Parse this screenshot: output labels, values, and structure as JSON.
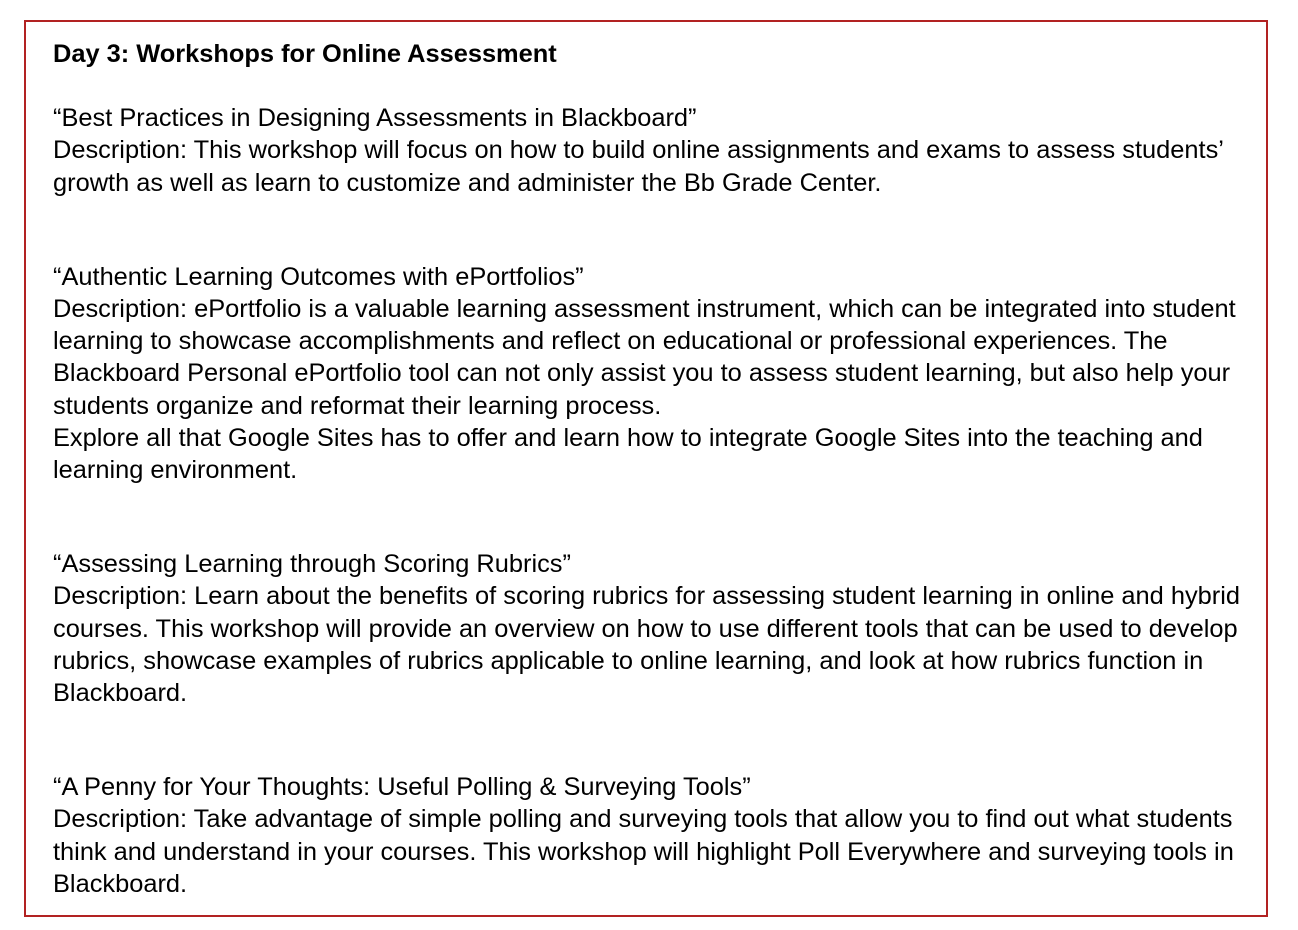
{
  "document": {
    "heading": "Day 3: Workshops for Online Assessment",
    "workshops": [
      {
        "title": "“Best Practices in Designing Assessments in Blackboard”",
        "description": "Description: This workshop will focus on how to build online assignments and exams to assess students’ growth as well as learn to customize and administer the Bb Grade Center.",
        "extra": ""
      },
      {
        "title": "“Authentic Learning Outcomes with ePortfolios”",
        "description": "Description: ePortfolio is a valuable learning assessment instrument, which can be integrated into student learning to showcase accomplishments and reflect on educational or professional experiences. The Blackboard Personal ePortfolio tool can not only assist you to assess student learning, but also help your students organize and reformat their learning process.",
        "extra": "Explore all that Google Sites has to offer and learn how to integrate Google Sites into the teaching and learning environment."
      },
      {
        "title": "“Assessing Learning through Scoring Rubrics”",
        "description": "Description: Learn about the benefits of scoring rubrics for assessing student learning in online and hybrid courses. This workshop will provide an overview on how to use different tools that can be used to develop rubrics, showcase examples of rubrics applicable to online learning, and look at how rubrics function in Blackboard.",
        "extra": ""
      },
      {
        "title": "“A Penny for Your Thoughts: Useful Polling & Surveying Tools”",
        "description": "Description: Take advantage of simple polling and surveying tools that allow you to find out what students think and understand in your courses. This workshop will highlight Poll Everywhere and surveying tools in Blackboard.",
        "extra": ""
      }
    ],
    "border_color": "#b22222"
  }
}
